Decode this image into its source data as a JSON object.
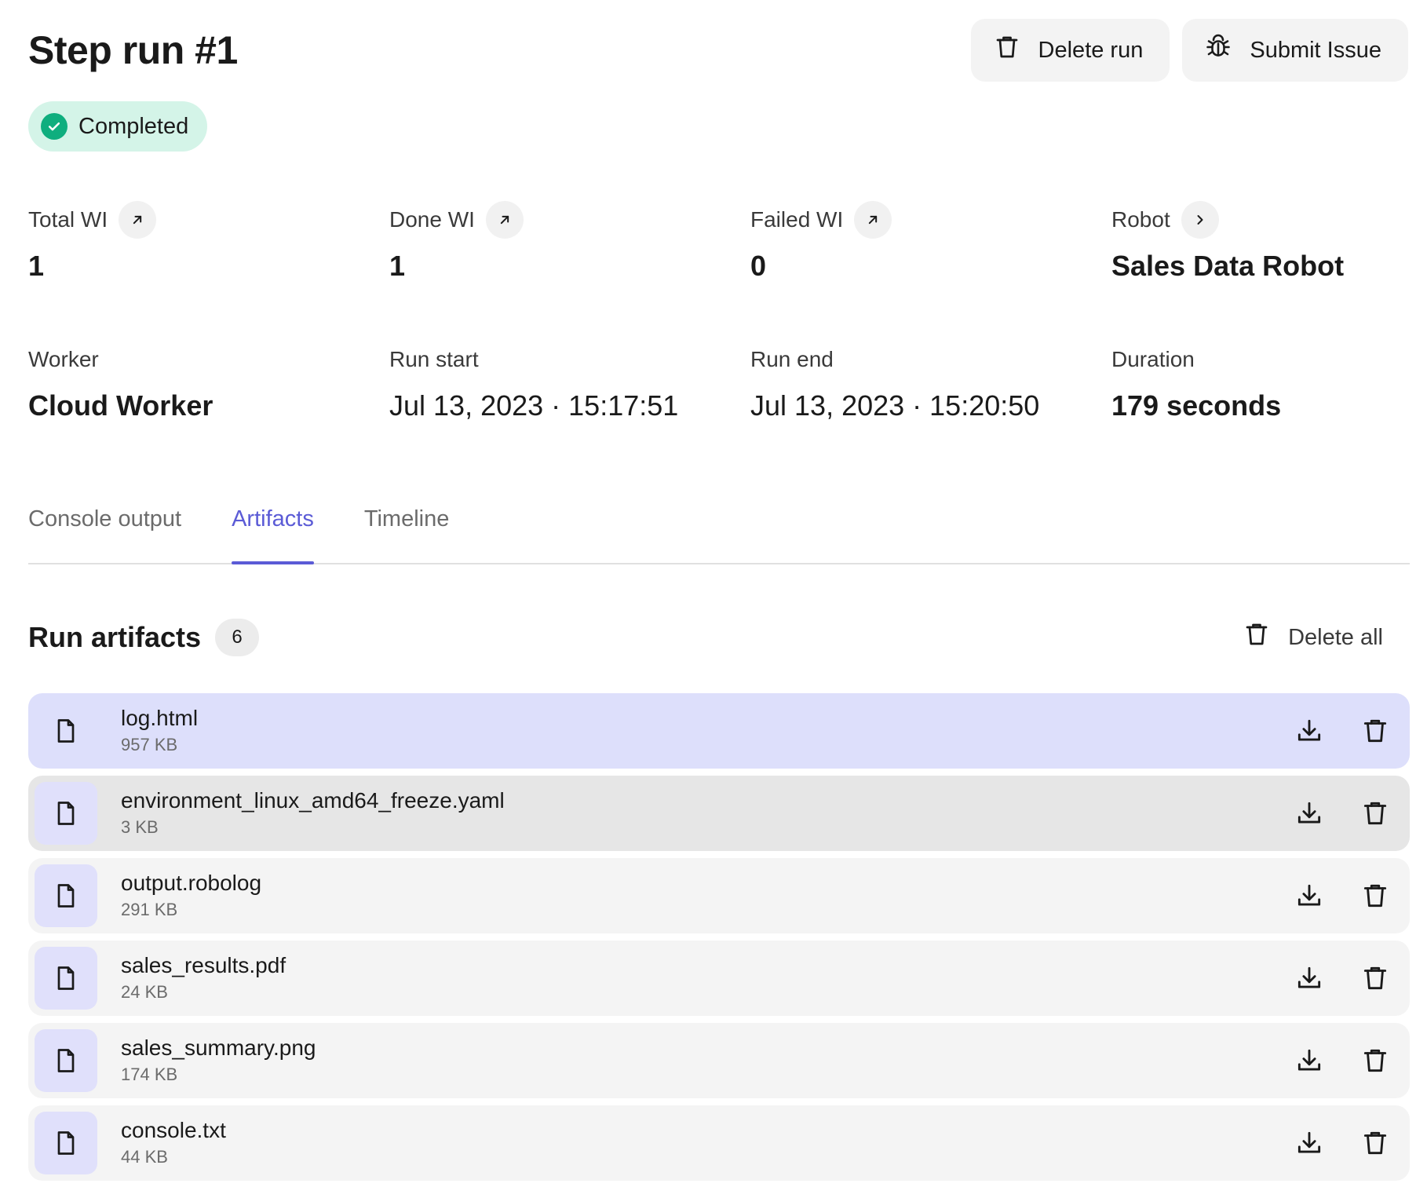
{
  "header": {
    "title": "Step run #1",
    "delete_run_label": "Delete run",
    "submit_issue_label": "Submit Issue"
  },
  "status": {
    "label": "Completed",
    "color": "#0fae7e"
  },
  "stats": {
    "total_wi": {
      "label": "Total WI",
      "value": "1"
    },
    "done_wi": {
      "label": "Done WI",
      "value": "1"
    },
    "failed_wi": {
      "label": "Failed WI",
      "value": "0"
    },
    "robot": {
      "label": "Robot",
      "value": "Sales Data Robot"
    },
    "worker": {
      "label": "Worker",
      "value": "Cloud Worker"
    },
    "run_start": {
      "label": "Run start",
      "value": "Jul 13, 2023 · 15:17:51"
    },
    "run_end": {
      "label": "Run end",
      "value": "Jul 13, 2023 · 15:20:50"
    },
    "duration": {
      "label": "Duration",
      "value": "179 seconds"
    }
  },
  "tabs": [
    {
      "label": "Console output",
      "active": false
    },
    {
      "label": "Artifacts",
      "active": true
    },
    {
      "label": "Timeline",
      "active": false
    }
  ],
  "artifacts": {
    "title": "Run artifacts",
    "count": "6",
    "delete_all_label": "Delete all",
    "items": [
      {
        "name": "log.html",
        "size": "957 KB",
        "state": "selected"
      },
      {
        "name": "environment_linux_amd64_freeze.yaml",
        "size": "3 KB",
        "state": "hovered"
      },
      {
        "name": "output.robolog",
        "size": "291 KB",
        "state": ""
      },
      {
        "name": "sales_results.pdf",
        "size": "24 KB",
        "state": ""
      },
      {
        "name": "sales_summary.png",
        "size": "174 KB",
        "state": ""
      },
      {
        "name": "console.txt",
        "size": "44 KB",
        "state": ""
      }
    ]
  },
  "colors": {
    "accent": "#5b5bd6",
    "selected_row": "#dddffb",
    "badge_bg": "#d4f4e8"
  }
}
